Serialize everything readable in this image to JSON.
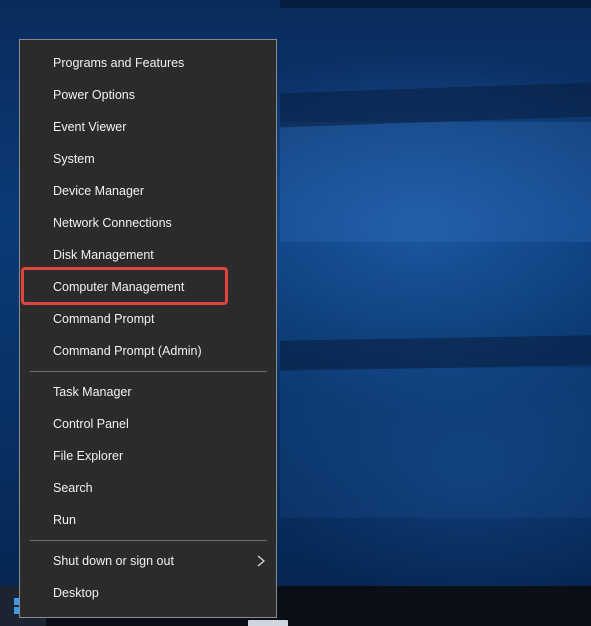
{
  "menu": {
    "items": [
      {
        "label": "Programs and Features"
      },
      {
        "label": "Power Options"
      },
      {
        "label": "Event Viewer"
      },
      {
        "label": "System"
      },
      {
        "label": "Device Manager"
      },
      {
        "label": "Network Connections"
      },
      {
        "label": "Disk Management"
      },
      {
        "label": "Computer Management"
      },
      {
        "label": "Command Prompt"
      },
      {
        "label": "Command Prompt (Admin)"
      },
      {
        "label": "Task Manager"
      },
      {
        "label": "Control Panel"
      },
      {
        "label": "File Explorer"
      },
      {
        "label": "Search"
      },
      {
        "label": "Run"
      },
      {
        "label": "Shut down or sign out"
      },
      {
        "label": "Desktop"
      }
    ],
    "highlighted_item": "Computer Management",
    "submenu_icon": "chevron-right-icon"
  },
  "taskbar": {
    "start_icon": "windows-logo-icon"
  },
  "colors": {
    "menu_background": "#2b2b2b",
    "menu_text": "#f2f2f2",
    "highlight_border": "#e0443f",
    "desktop_blue": "#0b3a78",
    "windows_logo": "#3b9be8"
  }
}
